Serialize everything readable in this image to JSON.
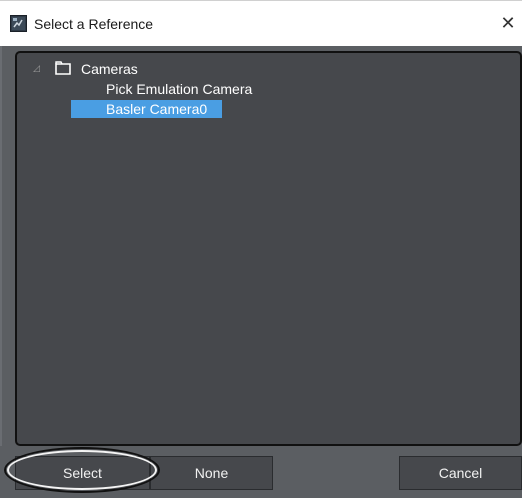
{
  "window": {
    "title": "Select a Reference",
    "close_glyph": "✕",
    "app_icon": "app-icon"
  },
  "tree": {
    "root": {
      "label": "Cameras",
      "expanded": true,
      "icon": "folder-icon"
    },
    "items": [
      {
        "label": "Pick Emulation Camera",
        "selected": false
      },
      {
        "label": "Basler Camera0",
        "selected": true
      }
    ],
    "expander_glyph": "◿",
    "selection_color": "#4a9ee3"
  },
  "buttons": {
    "select_label": "Select",
    "none_label": "None",
    "cancel_label": "Cancel"
  },
  "colors": {
    "panel_background": "#46484c",
    "dialog_background": "#5b5e62"
  }
}
